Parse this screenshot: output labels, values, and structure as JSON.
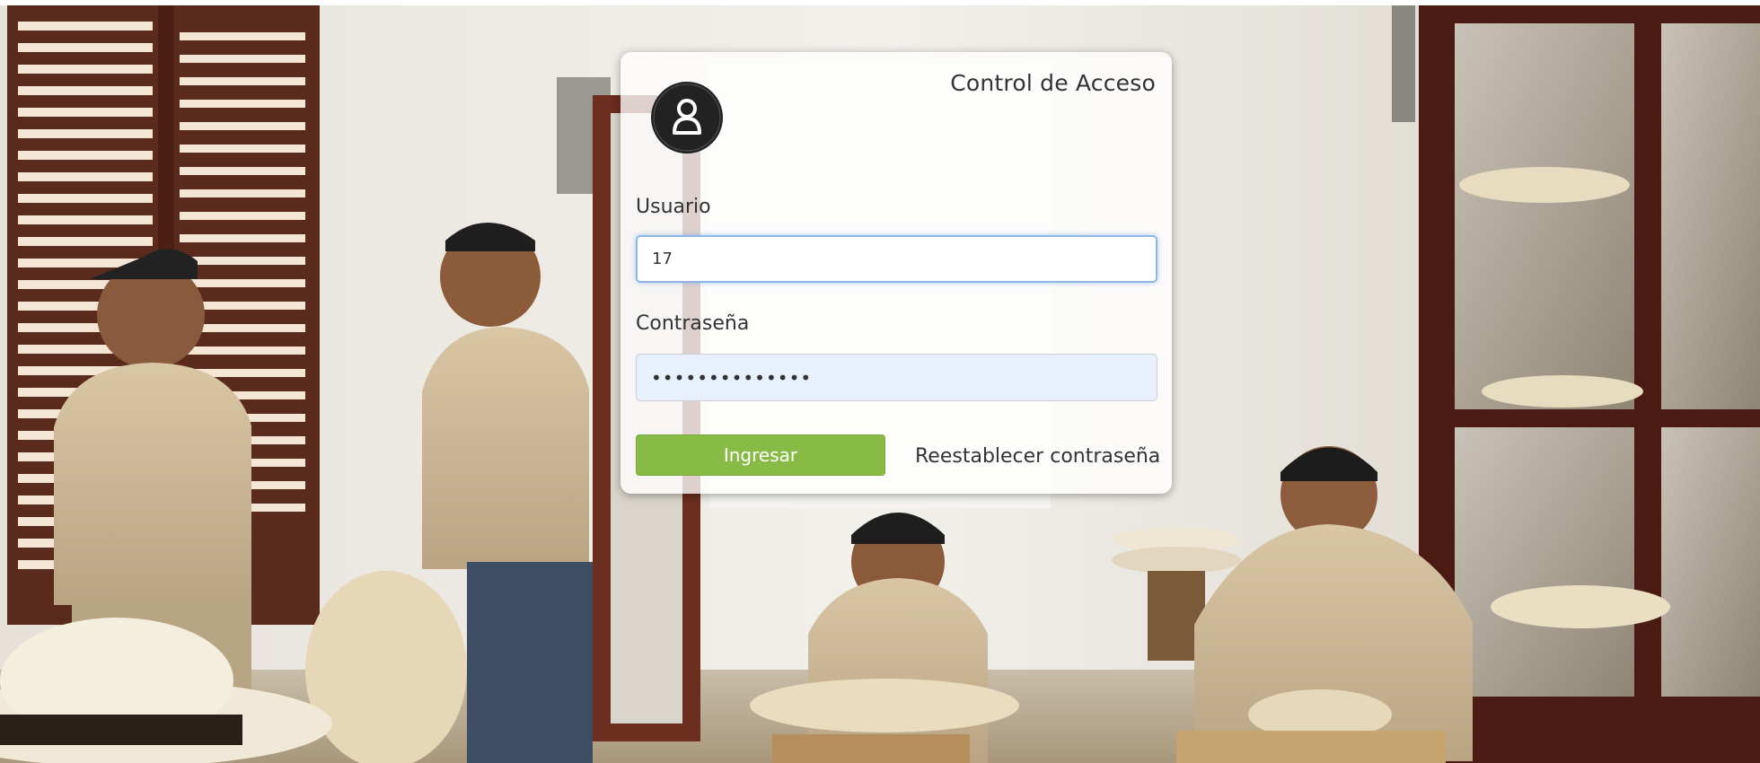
{
  "login": {
    "title": "Control de Acceso",
    "username_label": "Usuario",
    "username_value": "17",
    "password_label": "Contraseña",
    "password_value": "••••••••••••••",
    "submit_label": "Ingresar",
    "reset_link_label": "Reestablecer contraseña",
    "avatar_icon": "user-icon"
  },
  "colors": {
    "submit_button": "#88bb45",
    "focused_input_border": "#8fb7e6",
    "autofill_background": "#e8f0fe",
    "avatar_circle": "#222222"
  }
}
